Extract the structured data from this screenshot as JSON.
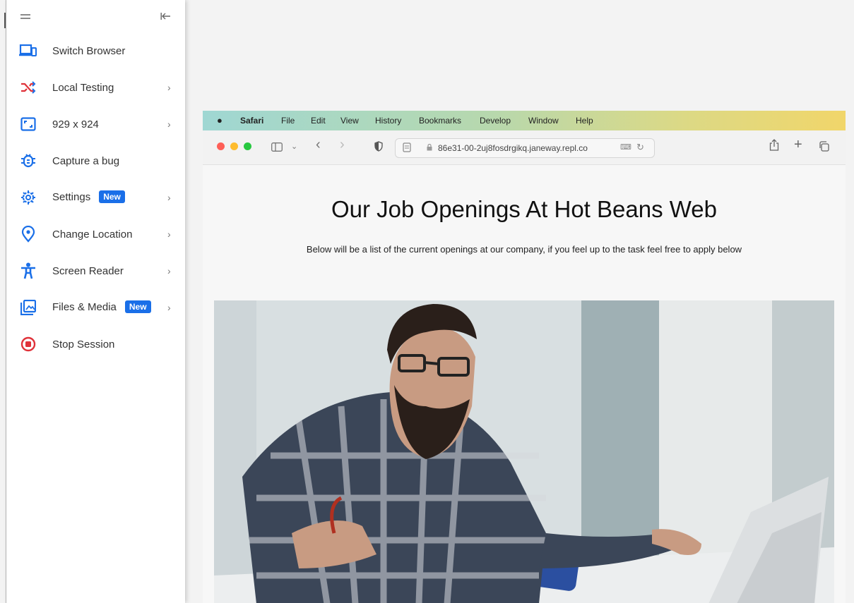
{
  "sidebar": {
    "items": [
      {
        "label": "Switch Browser",
        "icon": "devices-icon",
        "chevron": false,
        "badge": ""
      },
      {
        "label": "Local Testing",
        "icon": "shuffle-icon",
        "chevron": true,
        "badge": ""
      },
      {
        "label": "929 x 924",
        "icon": "resolution-icon",
        "chevron": true,
        "badge": ""
      },
      {
        "label": "Capture a bug",
        "icon": "bug-icon",
        "chevron": false,
        "badge": ""
      },
      {
        "label": "Settings",
        "icon": "gear-icon",
        "chevron": true,
        "badge": "New"
      },
      {
        "label": "Change Location",
        "icon": "location-pin-icon",
        "chevron": true,
        "badge": ""
      },
      {
        "label": "Screen Reader",
        "icon": "accessibility-icon",
        "chevron": true,
        "badge": ""
      },
      {
        "label": "Files & Media",
        "icon": "image-icon",
        "chevron": true,
        "badge": "New"
      },
      {
        "label": "Stop Session",
        "icon": "stop-icon",
        "chevron": false,
        "badge": ""
      }
    ]
  },
  "browser": {
    "menubar": [
      "Safari",
      "File",
      "Edit",
      "View",
      "History",
      "Bookmarks",
      "Develop",
      "Window",
      "Help"
    ],
    "url": "86e31-00-2uj8fosdrgikq.janeway.repl.co"
  },
  "page": {
    "title": "Our Job Openings At Hot Beans Web",
    "subtitle": "Below will be a list of the current openings at our company, if you feel up to the task feel free to apply below"
  },
  "colors": {
    "accent": "#1a6fe8",
    "stop": "#e0323a",
    "shuffle": "#e0323a"
  }
}
